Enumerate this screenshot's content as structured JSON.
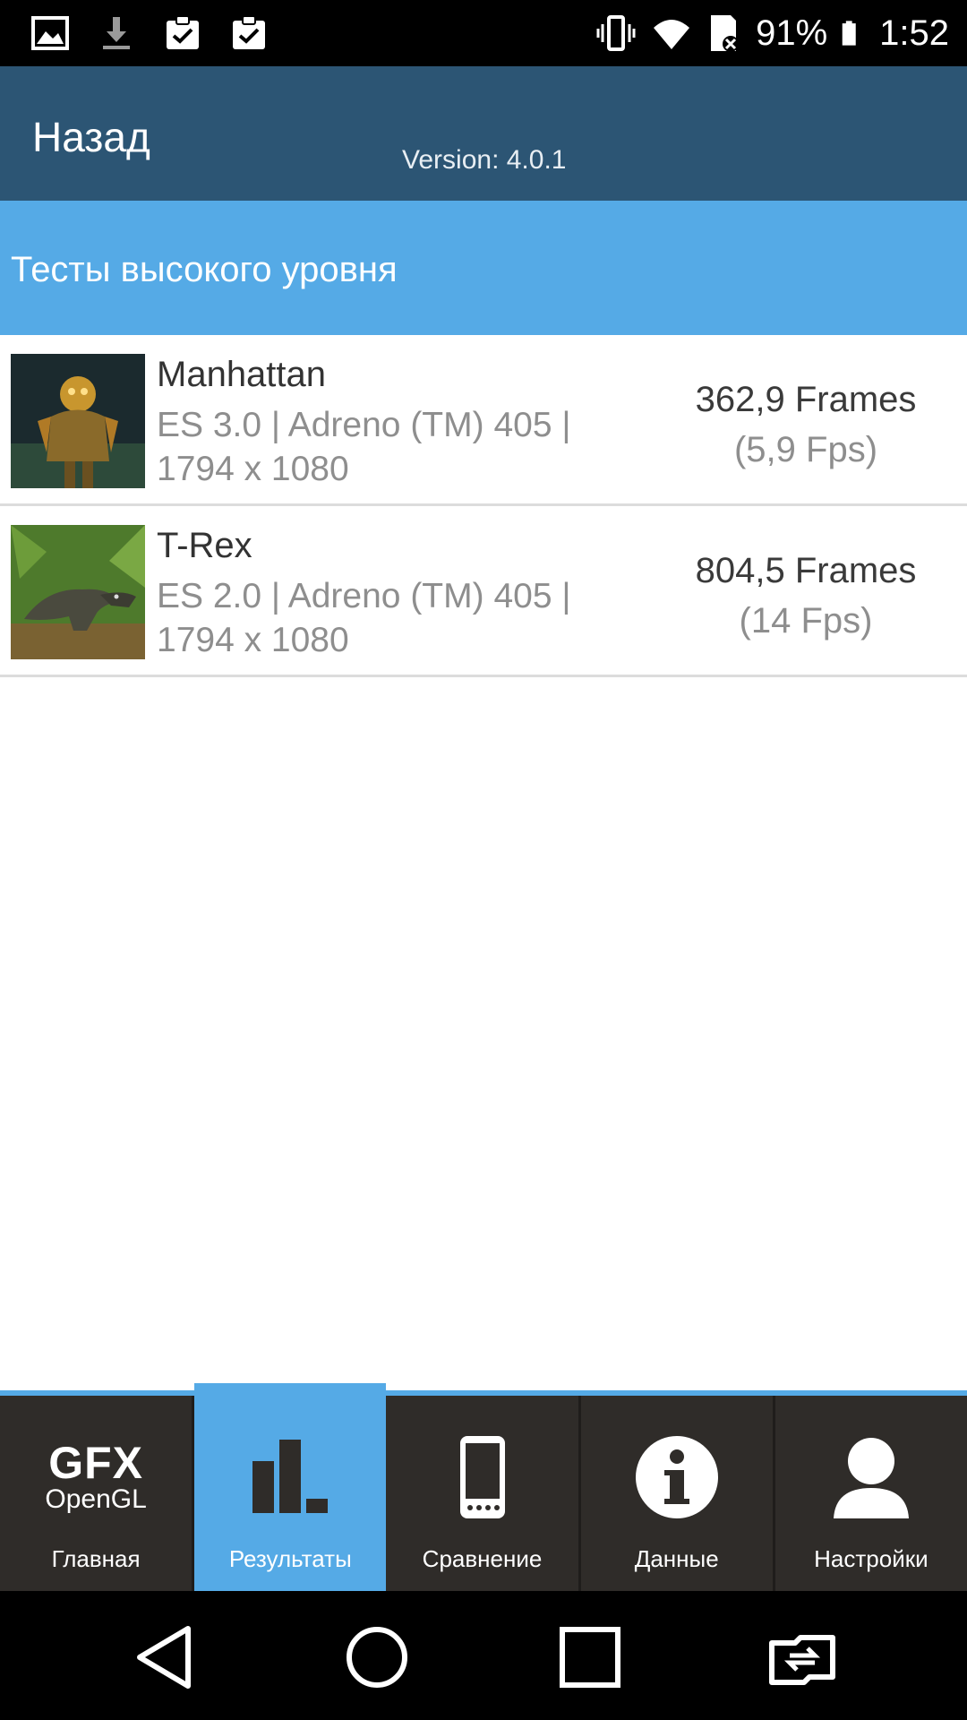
{
  "status_bar": {
    "battery_percent": "91%",
    "time": "1:52",
    "left_icons": [
      "image-icon",
      "download-icon",
      "clipboard-check-icon",
      "clipboard-check-icon"
    ],
    "right_icons": [
      "vibrate-icon",
      "wifi-icon",
      "sd-card-icon",
      "battery-icon"
    ]
  },
  "header": {
    "back_label": "Назад",
    "version": "Version: 4.0.1",
    "color": "#2c5574"
  },
  "section": {
    "title": "Тесты высокого уровня",
    "color": "#55aae6"
  },
  "results": [
    {
      "name": "Manhattan",
      "desc_line1": "ES 3.0 | Adreno (TM) 405 |",
      "desc_line2": "1794 x 1080",
      "frames": "362,9 Frames",
      "fps": "(5,9 Fps)",
      "thumb_icon": "manhattan-thumbnail"
    },
    {
      "name": "T-Rex",
      "desc_line1": "ES 2.0 | Adreno (TM) 405 |",
      "desc_line2": "1794 x 1080",
      "frames": "804,5 Frames",
      "fps": "(14 Fps)",
      "thumb_icon": "trex-thumbnail"
    }
  ],
  "tabs": [
    {
      "label": "Главная",
      "logo_line1": "GFX",
      "logo_line2": "OpenGL",
      "icon": "gfx-opengl-logo",
      "active": false
    },
    {
      "label": "Результаты",
      "icon": "bar-chart-icon",
      "active": true
    },
    {
      "label": "Сравнение",
      "icon": "phone-icon",
      "active": false
    },
    {
      "label": "Данные",
      "icon": "info-icon",
      "active": false
    },
    {
      "label": "Настройки",
      "icon": "user-icon",
      "active": false
    }
  ],
  "nav": [
    "back-icon",
    "home-icon",
    "recents-icon",
    "switch-app-icon"
  ]
}
